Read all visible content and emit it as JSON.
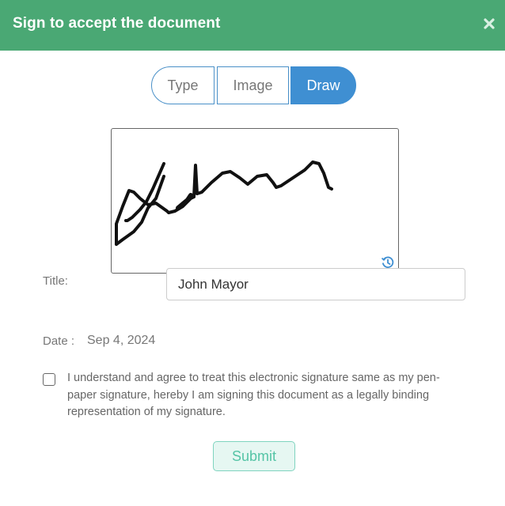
{
  "header": {
    "title": "Sign to accept the document"
  },
  "tabs": [
    {
      "label": "Type",
      "active": false
    },
    {
      "label": "Image",
      "active": false
    },
    {
      "label": "Draw",
      "active": true
    }
  ],
  "form": {
    "title_label": "Title:",
    "title_value": "John Mayor",
    "date_label": "Date :",
    "date_value": "Sep 4, 2024",
    "agreement_text": "I understand and agree to treat this electronic signature same as my pen-paper signature, hereby I am signing this document as a legally binding representation of my signature.",
    "submit_label": "Submit"
  },
  "colors": {
    "header": "#4aa874",
    "tab_active": "#3f8fd2",
    "submit_text": "#55c4a6"
  },
  "icons": {
    "close": "close-icon",
    "reset": "history-icon"
  }
}
